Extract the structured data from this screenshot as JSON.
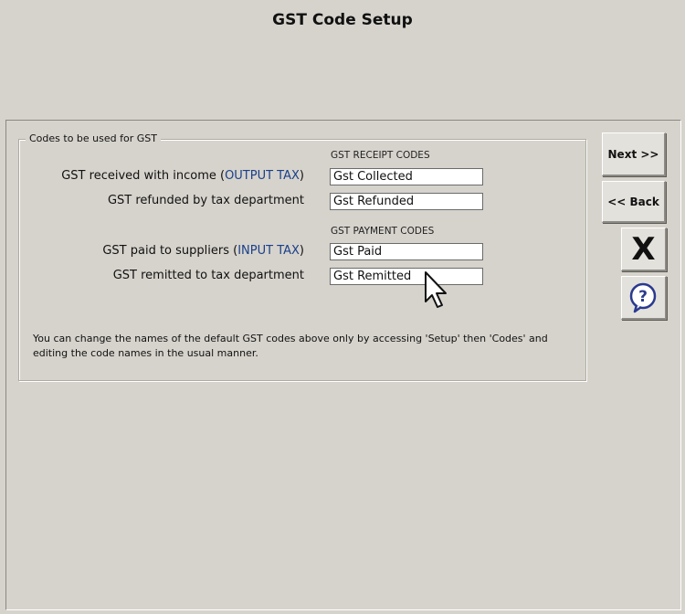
{
  "window": {
    "title": "GST Code Setup"
  },
  "group": {
    "legend": "Codes to be used for GST",
    "receipt_header": "GST RECEIPT CODES",
    "payment_header": "GST PAYMENT CODES",
    "rows": [
      {
        "label": "GST received with income (",
        "label_highlight": "OUTPUT TAX",
        "label_tail": ")",
        "value": "Gst Collected"
      },
      {
        "label": "GST refunded by tax department",
        "value": "Gst Refunded"
      },
      {
        "label": "GST paid to suppliers (",
        "label_highlight": "INPUT TAX",
        "label_tail": ")",
        "value": "Gst Paid"
      },
      {
        "label": "GST remitted to tax department",
        "value": "Gst Remitted"
      }
    ],
    "note": "You can change the names of the default GST codes above only by accessing 'Setup' then 'Codes' and editing the code names in the usual manner."
  },
  "buttons": {
    "next": "Next >>",
    "back": "<< Back",
    "close": "X",
    "help": "?"
  },
  "icons": {
    "close": "x-icon",
    "help": "help-icon",
    "cursor": "mouse-pointer-icon"
  },
  "colors": {
    "background": "#d6d3cc",
    "highlight_text": "#1a3f8a",
    "help_icon": "#2b3a8f"
  }
}
